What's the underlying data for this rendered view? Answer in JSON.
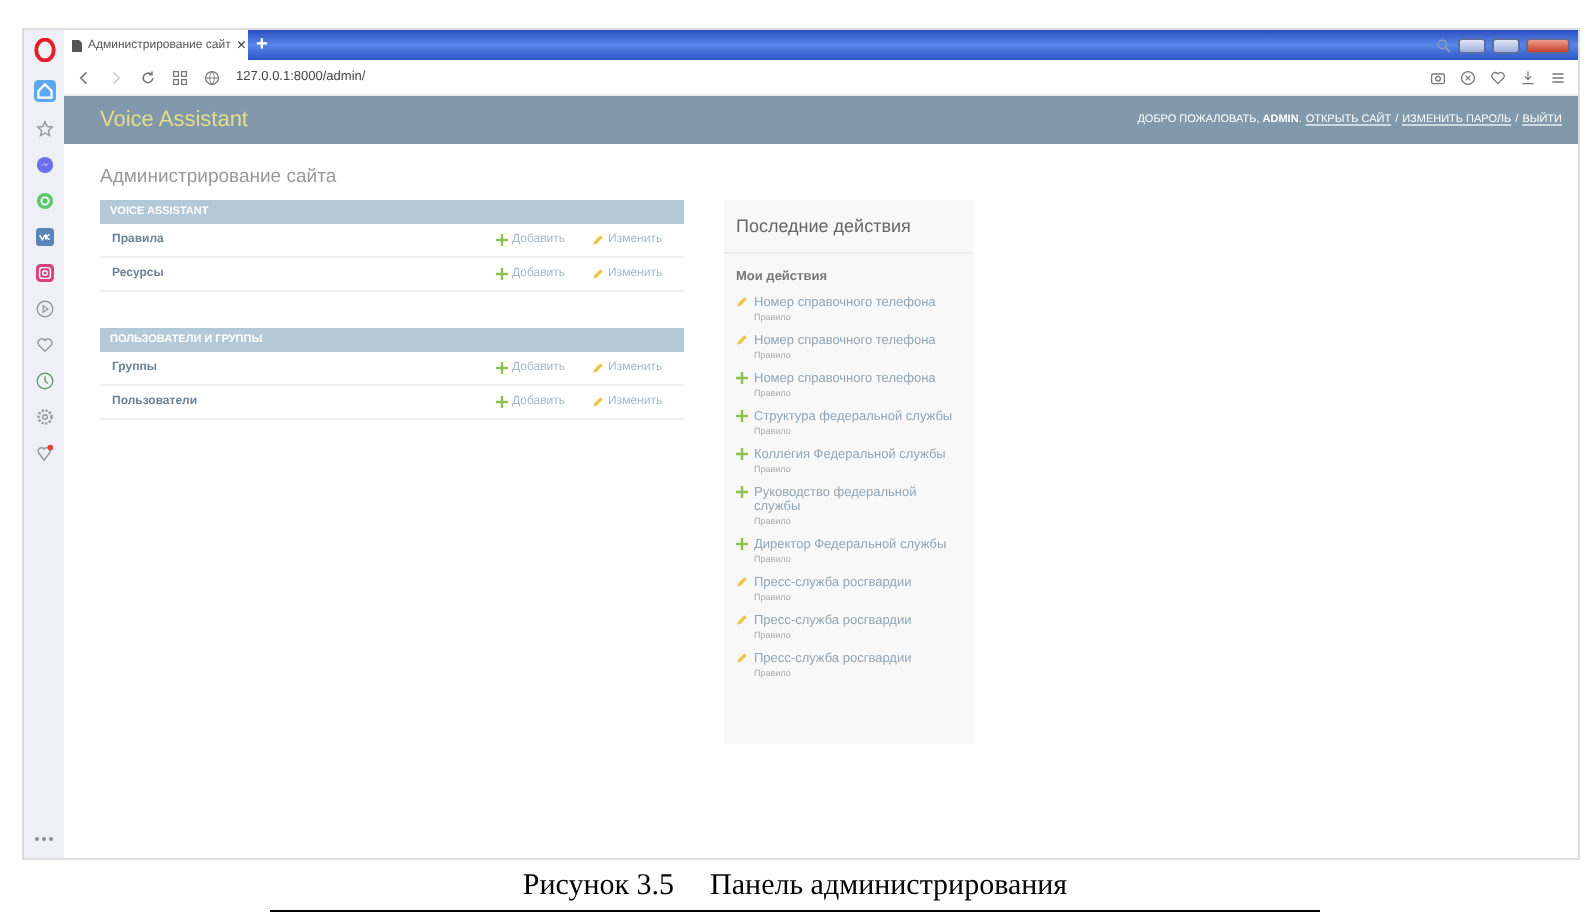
{
  "browser": {
    "tabs": [
      {
        "title": "Администрирование сайт",
        "close": "×",
        "selected": true
      }
    ],
    "new_tab": "+",
    "address": "127.0.0.1:8000/admin/"
  },
  "header": {
    "brand": "Voice Assistant",
    "welcome": "ДОБРО ПОЖАЛОВАТЬ, **ADMIN**.",
    "links": [
      "ОТКРЫТЬ САЙТ",
      "ИЗМЕНИТЬ ПАРОЛЬ",
      "ВЫЙТИ"
    ],
    "separators": [
      "/",
      "/"
    ]
  },
  "page_title": "Администрирование сайта",
  "modules": [
    {
      "caption": "VOICE ASSISTANT",
      "models": [
        {
          "name": "Правила",
          "add": "Добавить",
          "change": "Изменить"
        },
        {
          "name": "Ресурсы",
          "add": "Добавить",
          "change": "Изменить"
        }
      ]
    },
    {
      "caption": "ПОЛЬЗОВАТЕЛИ И ГРУППЫ",
      "models": [
        {
          "name": "Группы",
          "add": "Добавить",
          "change": "Изменить"
        },
        {
          "name": "Пользователи",
          "add": "Добавить",
          "change": "Изменить"
        }
      ]
    }
  ],
  "recent_actions": {
    "title": "Последние действия",
    "subtitle": "Мои действия",
    "items": [
      {
        "kind": "change",
        "label": "Номер справочного телефона",
        "type": "Правило"
      },
      {
        "kind": "change",
        "label": "Номер справочного телефона",
        "type": "Правило"
      },
      {
        "kind": "add",
        "label": "Номер справочного телефона",
        "type": "Правило"
      },
      {
        "kind": "add",
        "label": "Структура федеральной службы",
        "type": "Правило"
      },
      {
        "kind": "add",
        "label": "Коллегия Федеральной службы",
        "type": "Правило"
      },
      {
        "kind": "add",
        "label": "Руководство федеральной службы",
        "type": "Правило"
      },
      {
        "kind": "add",
        "label": "Директор Федеральной службы",
        "type": "Правило"
      },
      {
        "kind": "change",
        "label": "Пресс-служба росгвардии",
        "type": "Правило"
      },
      {
        "kind": "change",
        "label": "Пресс-служба росгвардии",
        "type": "Правило"
      },
      {
        "kind": "change",
        "label": "Пресс-служба росгвардии",
        "type": "Правило"
      }
    ]
  },
  "figure_caption": {
    "number": "Рисунок 3.5",
    "text": "Панель администрирования"
  }
}
